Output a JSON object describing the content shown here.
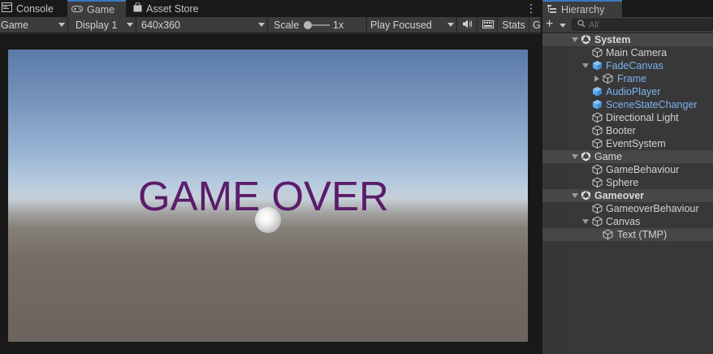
{
  "tabs": {
    "console": "Console",
    "game": "Game",
    "asset_store": "Asset Store"
  },
  "game_toolbar": {
    "mode": "Game",
    "display": "Display 1",
    "resolution": "640x360",
    "scale_label": "Scale",
    "scale_value": "1x",
    "play_mode": "Play Focused",
    "stats": "Stats",
    "gizmos": "G"
  },
  "viewport": {
    "text": "GAME OVER",
    "text_color": "#5b1c6a"
  },
  "hierarchy": {
    "tab": "Hierarchy",
    "search_placeholder": "All",
    "items": [
      {
        "label": "System"
      },
      {
        "label": "Main Camera"
      },
      {
        "label": "FadeCanvas"
      },
      {
        "label": "Frame"
      },
      {
        "label": "AudioPlayer"
      },
      {
        "label": "SceneStateChanger"
      },
      {
        "label": "Directional Light"
      },
      {
        "label": "Booter"
      },
      {
        "label": "EventSystem"
      },
      {
        "label": "Game"
      },
      {
        "label": "GameBehaviour"
      },
      {
        "label": "Sphere"
      },
      {
        "label": "Gameover"
      },
      {
        "label": "GameoverBehaviour"
      },
      {
        "label": "Canvas"
      },
      {
        "label": "Text (TMP)"
      }
    ]
  },
  "colors": {
    "accent": "#3a79bb",
    "prefab": "#7cb3ee",
    "panel": "#383838"
  }
}
